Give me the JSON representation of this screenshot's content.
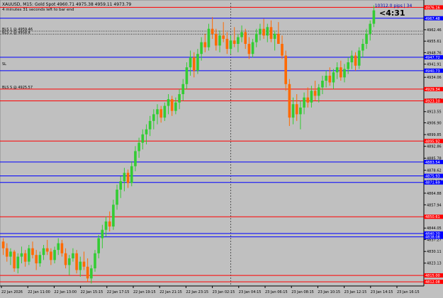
{
  "window": {
    "title": "XAUUSD, M15: Gold Spot  4960.71 4975.38 4959.11 4973.79",
    "subtitle": "4 minutes 31 seconds left to bar end"
  },
  "top_right": {
    "pips_label": "10312.0 pips | 34",
    "countdown": "<4:31"
  },
  "colors": {
    "background": "#c0c0c0",
    "bull": "#33cc33",
    "bear": "#ff6a00",
    "wick": "#000000",
    "blue_line": "#0000ff",
    "red_line": "#ff0000",
    "price_axis_bg": "#c0c0c0"
  },
  "left_labels": [
    {
      "text": "BLS 1 @ 4959.46",
      "price": 4961.6
    },
    {
      "text": "BLS 2 @ 4958.4",
      "price": 4959.8
    },
    {
      "text": "SL",
      "price": 4940.8
    },
    {
      "text": "BLS S @ 4925.57",
      "price": 4927.0
    }
  ],
  "chart_data": {
    "type": "candlestick",
    "title": "XAUUSD, M15",
    "ylim": [
      4809.5,
      4978.5
    ],
    "y_ticks": [
      4976.16,
      4969.31,
      4962.46,
      4955.61,
      4948.76,
      4941.91,
      4934.06,
      4927.4,
      4920.58,
      4913.55,
      4906.9,
      4899.85,
      4892.86,
      4885.78,
      4878.62,
      4871.95,
      4864.88,
      4857.94,
      4851.05,
      4844.05,
      4837.27,
      4830.11,
      4823.13,
      4816.18
    ],
    "x_ticks": [
      "22 Jan 2026",
      "22 Jan 11:00",
      "22 Jan 13:00",
      "22 Jan 15:15",
      "22 Jan 17:15",
      "22 Jan 19:15",
      "22 Jan 21:15",
      "22 Jan 23:15",
      "23 Jan 02:15",
      "23 Jan 04:15",
      "23 Jan 06:15",
      "23 Jan 08:15",
      "23 Jan 10:15",
      "23 Jan 12:15",
      "23 Jan 14:15",
      "23 Jan 16:15"
    ],
    "candles": [
      [
        4836,
        4838,
        4828,
        4832
      ],
      [
        4832,
        4835,
        4824,
        4827
      ],
      [
        4827,
        4832,
        4822,
        4830
      ],
      [
        4830,
        4831,
        4818,
        4820
      ],
      [
        4820,
        4829,
        4817,
        4827
      ],
      [
        4827,
        4833,
        4823,
        4829
      ],
      [
        4829,
        4831,
        4821,
        4824
      ],
      [
        4824,
        4834,
        4822,
        4832
      ],
      [
        4832,
        4836,
        4826,
        4828
      ],
      [
        4828,
        4831,
        4819,
        4823
      ],
      [
        4823,
        4830,
        4821,
        4828
      ],
      [
        4828,
        4834,
        4825,
        4832
      ],
      [
        4832,
        4837,
        4828,
        4830
      ],
      [
        4830,
        4832,
        4822,
        4825
      ],
      [
        4825,
        4833,
        4823,
        4831
      ],
      [
        4831,
        4838,
        4828,
        4835
      ],
      [
        4835,
        4837,
        4827,
        4829
      ],
      [
        4829,
        4832,
        4820,
        4822
      ],
      [
        4822,
        4828,
        4816,
        4826
      ],
      [
        4826,
        4832,
        4824,
        4829
      ],
      [
        4829,
        4831,
        4817,
        4819
      ],
      [
        4819,
        4827,
        4815,
        4824
      ],
      [
        4824,
        4830,
        4819,
        4821
      ],
      [
        4821,
        4826,
        4812,
        4814
      ],
      [
        4814,
        4822,
        4811,
        4820
      ],
      [
        4820,
        4831,
        4818,
        4829
      ],
      [
        4829,
        4840,
        4826,
        4838
      ],
      [
        4838,
        4846,
        4832,
        4843
      ],
      [
        4843,
        4851,
        4839,
        4848
      ],
      [
        4848,
        4854,
        4842,
        4845
      ],
      [
        4845,
        4861,
        4843,
        4858
      ],
      [
        4858,
        4870,
        4855,
        4867
      ],
      [
        4867,
        4875,
        4862,
        4872
      ],
      [
        4872,
        4880,
        4866,
        4877
      ],
      [
        4877,
        4879,
        4868,
        4871
      ],
      [
        4871,
        4884,
        4869,
        4881
      ],
      [
        4881,
        4893,
        4878,
        4890
      ],
      [
        4890,
        4898,
        4886,
        4895
      ],
      [
        4895,
        4903,
        4891,
        4900
      ],
      [
        4900,
        4906,
        4894,
        4903
      ],
      [
        4903,
        4911,
        4899,
        4908
      ],
      [
        4908,
        4915,
        4903,
        4912
      ],
      [
        4912,
        4918,
        4906,
        4915
      ],
      [
        4915,
        4917,
        4907,
        4910
      ],
      [
        4910,
        4919,
        4908,
        4917
      ],
      [
        4917,
        4924,
        4912,
        4921
      ],
      [
        4921,
        4923,
        4911,
        4914
      ],
      [
        4914,
        4922,
        4912,
        4919
      ],
      [
        4919,
        4927,
        4915,
        4924
      ],
      [
        4924,
        4933,
        4920,
        4930
      ],
      [
        4930,
        4943,
        4927,
        4940
      ],
      [
        4940,
        4950,
        4935,
        4946
      ],
      [
        4946,
        4949,
        4934,
        4938
      ],
      [
        4938,
        4951,
        4936,
        4948
      ],
      [
        4948,
        4958,
        4944,
        4955
      ],
      [
        4955,
        4960,
        4949,
        4952
      ],
      [
        4952,
        4966,
        4950,
        4963
      ],
      [
        4963,
        4970,
        4957,
        4960
      ],
      [
        4960,
        4963,
        4950,
        4953
      ],
      [
        4953,
        4962,
        4949,
        4959
      ],
      [
        4959,
        4967,
        4955,
        4957
      ],
      [
        4957,
        4961,
        4948,
        4951
      ],
      [
        4951,
        4959,
        4948,
        4956
      ],
      [
        4956,
        4964,
        4952,
        4954
      ],
      [
        4954,
        4960,
        4949,
        4958
      ],
      [
        4958,
        4965,
        4955,
        4961
      ],
      [
        4961,
        4963,
        4951,
        4954
      ],
      [
        4954,
        4958,
        4945,
        4948
      ],
      [
        4948,
        4957,
        4946,
        4955
      ],
      [
        4955,
        4963,
        4952,
        4960
      ],
      [
        4960,
        4966,
        4956,
        4963
      ],
      [
        4963,
        4969,
        4957,
        4959
      ],
      [
        4959,
        4966,
        4955,
        4964
      ],
      [
        4964,
        4968,
        4955,
        4957
      ],
      [
        4957,
        4962,
        4950,
        4960
      ],
      [
        4960,
        4967,
        4956,
        4954
      ],
      [
        4954,
        4959,
        4945,
        4947
      ],
      [
        4947,
        4950,
        4926,
        4930
      ],
      [
        4930,
        4933,
        4905,
        4910
      ],
      [
        4910,
        4922,
        4906,
        4918
      ],
      [
        4918,
        4924,
        4908,
        4912
      ],
      [
        4912,
        4920,
        4903,
        4916
      ],
      [
        4916,
        4925,
        4912,
        4922
      ],
      [
        4922,
        4928,
        4916,
        4919
      ],
      [
        4919,
        4929,
        4916,
        4926
      ],
      [
        4926,
        4932,
        4920,
        4923
      ],
      [
        4923,
        4930,
        4919,
        4928
      ],
      [
        4928,
        4935,
        4924,
        4932
      ],
      [
        4932,
        4938,
        4928,
        4935
      ],
      [
        4935,
        4940,
        4929,
        4931
      ],
      [
        4931,
        4939,
        4927,
        4937
      ],
      [
        4937,
        4943,
        4933,
        4940
      ],
      [
        4940,
        4944,
        4932,
        4934
      ],
      [
        4934,
        4942,
        4931,
        4939
      ],
      [
        4939,
        4946,
        4936,
        4943
      ],
      [
        4943,
        4950,
        4939,
        4947
      ],
      [
        4947,
        4949,
        4938,
        4941
      ],
      [
        4941,
        4952,
        4939,
        4950
      ],
      [
        4950,
        4957,
        4946,
        4954
      ],
      [
        4954,
        4963,
        4951,
        4960
      ],
      [
        4960,
        4968,
        4956,
        4966
      ],
      [
        4966,
        4977,
        4964,
        4974
      ]
    ],
    "hlines": [
      {
        "price": 4975.8,
        "color": "#ff0000",
        "label": "4976.16"
      },
      {
        "price": 4969.3,
        "color": "#0000ff",
        "label": "4967.48"
      },
      {
        "price": 4946.0,
        "color": "#0000ff",
        "label": "4947.72"
      },
      {
        "price": 4938.0,
        "color": "#0000ff",
        "label": "4940.73"
      },
      {
        "price": 4927.0,
        "color": "#ff0000",
        "label": "4929.34"
      },
      {
        "price": 4920.0,
        "color": "#ff0000",
        "label": "4923.10"
      },
      {
        "price": 4896.0,
        "color": "#ff0000",
        "label": "4895.92"
      },
      {
        "price": 4883.5,
        "color": "#0000ff",
        "label": "4883.54"
      },
      {
        "price": 4875.2,
        "color": "#0000ff",
        "label": "4875.93"
      },
      {
        "price": 4871.3,
        "color": "#0000ff",
        "label": "4871.69"
      },
      {
        "price": 4850.8,
        "color": "#ff0000",
        "label": "4850.61"
      },
      {
        "price": 4840.8,
        "color": "#0000ff",
        "label": "4840.20"
      },
      {
        "price": 4838.8,
        "color": "#0000ff",
        "label": "4838.08"
      },
      {
        "price": 4815.8,
        "color": "#ff0000",
        "label": "4815.00"
      },
      {
        "price": 4812.0,
        "color": "#ff0000",
        "label": "4812.08"
      }
    ],
    "dotted_hlines": [
      4961.6,
      4959.8
    ],
    "vline_index": 62
  }
}
